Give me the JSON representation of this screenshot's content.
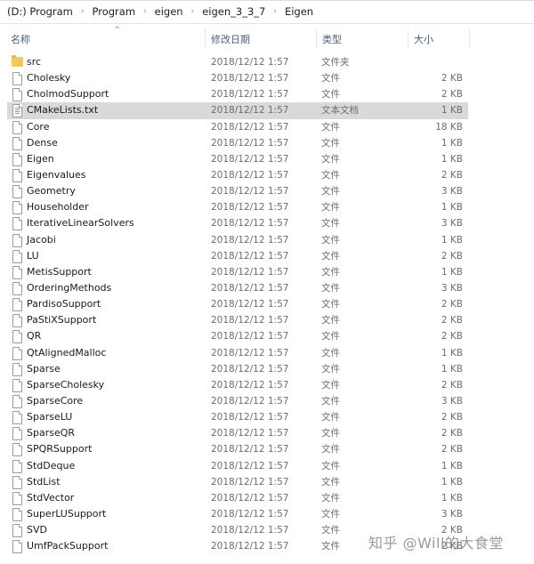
{
  "breadcrumb": [
    "(D:) Program",
    "Program",
    "eigen",
    "eigen_3_3_7",
    "Eigen"
  ],
  "breadcrumb_separator": "›",
  "columns": {
    "name": "名称",
    "date": "修改日期",
    "type": "类型",
    "size": "大小",
    "sort_indicator": "^"
  },
  "files": [
    {
      "name": "src",
      "date": "2018/12/12 1:57",
      "type": "文件夹",
      "size": "",
      "icon": "folder-icon"
    },
    {
      "name": "Cholesky",
      "date": "2018/12/12 1:57",
      "type": "文件",
      "size": "2 KB",
      "icon": "file-icon"
    },
    {
      "name": "CholmodSupport",
      "date": "2018/12/12 1:57",
      "type": "文件",
      "size": "2 KB",
      "icon": "file-icon"
    },
    {
      "name": "CMakeLists.txt",
      "date": "2018/12/12 1:57",
      "type": "文本文档",
      "size": "1 KB",
      "icon": "text-file-icon",
      "selected": true
    },
    {
      "name": "Core",
      "date": "2018/12/12 1:57",
      "type": "文件",
      "size": "18 KB",
      "icon": "file-icon"
    },
    {
      "name": "Dense",
      "date": "2018/12/12 1:57",
      "type": "文件",
      "size": "1 KB",
      "icon": "file-icon"
    },
    {
      "name": "Eigen",
      "date": "2018/12/12 1:57",
      "type": "文件",
      "size": "1 KB",
      "icon": "file-icon"
    },
    {
      "name": "Eigenvalues",
      "date": "2018/12/12 1:57",
      "type": "文件",
      "size": "2 KB",
      "icon": "file-icon"
    },
    {
      "name": "Geometry",
      "date": "2018/12/12 1:57",
      "type": "文件",
      "size": "3 KB",
      "icon": "file-icon"
    },
    {
      "name": "Householder",
      "date": "2018/12/12 1:57",
      "type": "文件",
      "size": "1 KB",
      "icon": "file-icon"
    },
    {
      "name": "IterativeLinearSolvers",
      "date": "2018/12/12 1:57",
      "type": "文件",
      "size": "3 KB",
      "icon": "file-icon"
    },
    {
      "name": "Jacobi",
      "date": "2018/12/12 1:57",
      "type": "文件",
      "size": "1 KB",
      "icon": "file-icon"
    },
    {
      "name": "LU",
      "date": "2018/12/12 1:57",
      "type": "文件",
      "size": "2 KB",
      "icon": "file-icon"
    },
    {
      "name": "MetisSupport",
      "date": "2018/12/12 1:57",
      "type": "文件",
      "size": "1 KB",
      "icon": "file-icon"
    },
    {
      "name": "OrderingMethods",
      "date": "2018/12/12 1:57",
      "type": "文件",
      "size": "3 KB",
      "icon": "file-icon"
    },
    {
      "name": "PardisoSupport",
      "date": "2018/12/12 1:57",
      "type": "文件",
      "size": "2 KB",
      "icon": "file-icon"
    },
    {
      "name": "PaStiXSupport",
      "date": "2018/12/12 1:57",
      "type": "文件",
      "size": "2 KB",
      "icon": "file-icon"
    },
    {
      "name": "QR",
      "date": "2018/12/12 1:57",
      "type": "文件",
      "size": "2 KB",
      "icon": "file-icon"
    },
    {
      "name": "QtAlignedMalloc",
      "date": "2018/12/12 1:57",
      "type": "文件",
      "size": "1 KB",
      "icon": "file-icon"
    },
    {
      "name": "Sparse",
      "date": "2018/12/12 1:57",
      "type": "文件",
      "size": "1 KB",
      "icon": "file-icon"
    },
    {
      "name": "SparseCholesky",
      "date": "2018/12/12 1:57",
      "type": "文件",
      "size": "2 KB",
      "icon": "file-icon"
    },
    {
      "name": "SparseCore",
      "date": "2018/12/12 1:57",
      "type": "文件",
      "size": "3 KB",
      "icon": "file-icon"
    },
    {
      "name": "SparseLU",
      "date": "2018/12/12 1:57",
      "type": "文件",
      "size": "2 KB",
      "icon": "file-icon"
    },
    {
      "name": "SparseQR",
      "date": "2018/12/12 1:57",
      "type": "文件",
      "size": "2 KB",
      "icon": "file-icon"
    },
    {
      "name": "SPQRSupport",
      "date": "2018/12/12 1:57",
      "type": "文件",
      "size": "2 KB",
      "icon": "file-icon"
    },
    {
      "name": "StdDeque",
      "date": "2018/12/12 1:57",
      "type": "文件",
      "size": "1 KB",
      "icon": "file-icon"
    },
    {
      "name": "StdList",
      "date": "2018/12/12 1:57",
      "type": "文件",
      "size": "1 KB",
      "icon": "file-icon"
    },
    {
      "name": "StdVector",
      "date": "2018/12/12 1:57",
      "type": "文件",
      "size": "1 KB",
      "icon": "file-icon"
    },
    {
      "name": "SuperLUSupport",
      "date": "2018/12/12 1:57",
      "type": "文件",
      "size": "3 KB",
      "icon": "file-icon"
    },
    {
      "name": "SVD",
      "date": "2018/12/12 1:57",
      "type": "文件",
      "size": "2 KB",
      "icon": "file-icon"
    },
    {
      "name": "UmfPackSupport",
      "date": "2018/12/12 1:57",
      "type": "文件",
      "size": "2 KB",
      "icon": "file-icon"
    }
  ],
  "watermark": "知乎 @Will的大食堂",
  "colors": {
    "selected_row": "#d9d9d9",
    "header_text": "#4c607a",
    "folder": "#f3c95a",
    "secondary_text": "#6d6d6d"
  }
}
